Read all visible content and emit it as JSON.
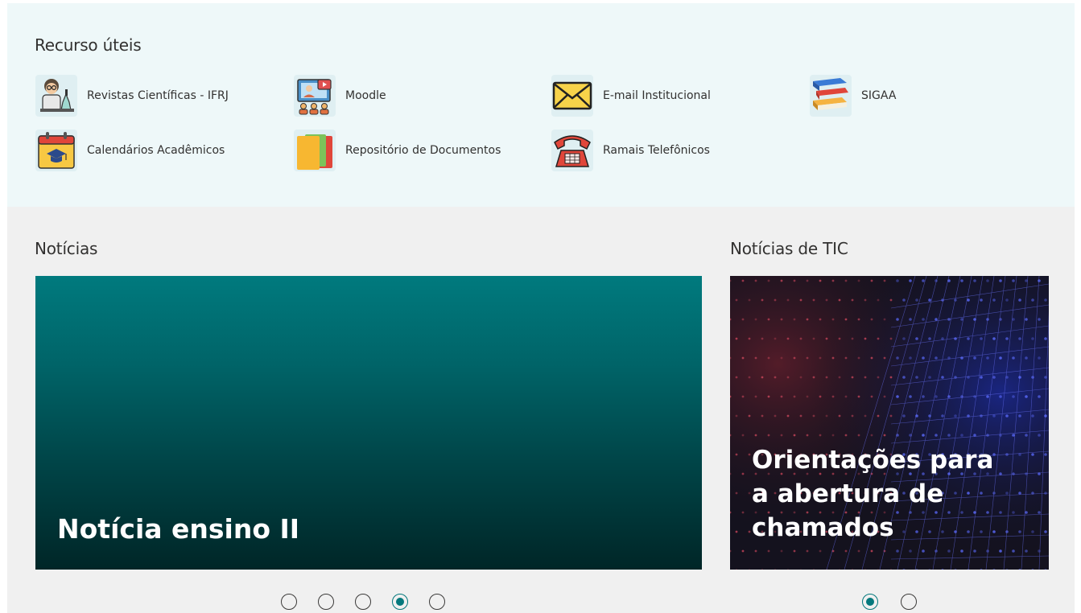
{
  "resources": {
    "title": "Recurso úteis",
    "items": [
      {
        "label": "Revistas Científicas - IFRJ",
        "icon": "scientist-icon"
      },
      {
        "label": "Moodle",
        "icon": "online-class-icon"
      },
      {
        "label": "E-mail Institucional",
        "icon": "envelope-icon"
      },
      {
        "label": "SIGAA",
        "icon": "books-icon"
      },
      {
        "label": "Calendários Acadêmicos",
        "icon": "calendar-graduation-icon"
      },
      {
        "label": "Repositório de Documentos",
        "icon": "documents-icon"
      },
      {
        "label": "Ramais Telefônicos",
        "icon": "telephone-icon"
      }
    ]
  },
  "news": {
    "title": "Notícias",
    "active_slide": 4,
    "slide_count": 5,
    "slide_title": "Notícia ensino II"
  },
  "tic": {
    "title": "Notícias de TIC",
    "active_slide": 1,
    "slide_count": 2,
    "slide_title": "Orientações para a abertura de chamados"
  },
  "colors": {
    "accent": "#03787c",
    "resources_bg": "#eef8f9",
    "news_bg": "#f0f0f0"
  }
}
